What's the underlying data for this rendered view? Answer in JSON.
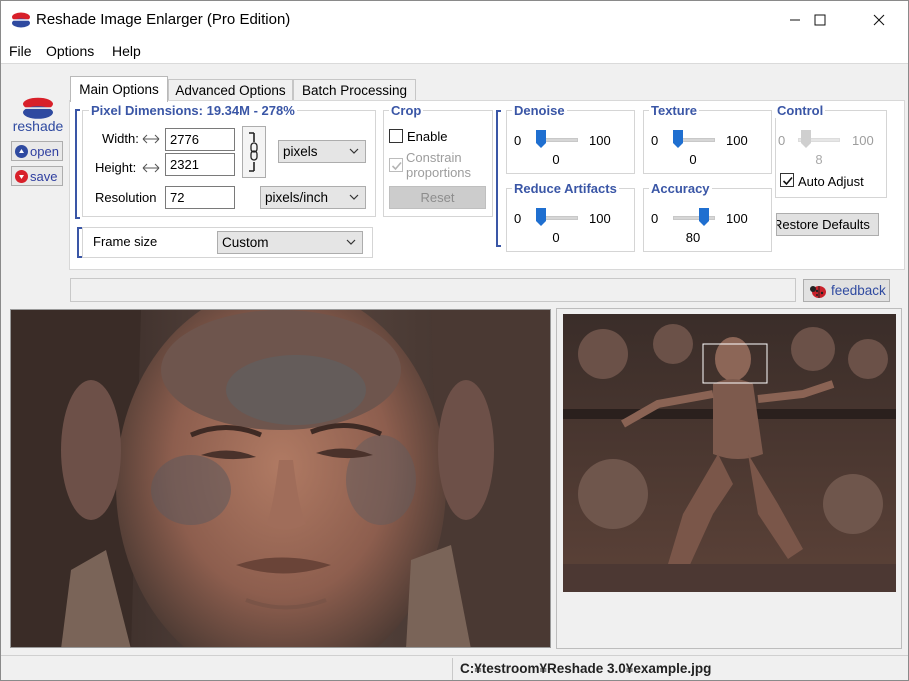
{
  "window": {
    "title": "Reshade Image Enlarger (Pro Edition)",
    "minimize_glyph": "—",
    "maximize_glyph": "☐",
    "close_glyph": "✕"
  },
  "menu": [
    "File",
    "Options",
    "Help"
  ],
  "sidebar": {
    "brand": "reshade",
    "open_label": "open",
    "save_label": "save"
  },
  "tabs": [
    "Main Options",
    "Advanced Options",
    "Batch Processing"
  ],
  "active_tab": "Main Options",
  "pixel_dimensions": {
    "title": "Pixel Dimensions:  19.34M - 278%",
    "width_label": "Width:",
    "width_value": "2776",
    "height_label": "Height:",
    "height_value": "2321",
    "unit": "pixels",
    "resolution_label": "Resolution",
    "resolution_value": "72",
    "resolution_unit": "pixels/inch"
  },
  "frame": {
    "label": "Frame size",
    "value": "Custom"
  },
  "crop": {
    "title": "Crop",
    "enable_label": "Enable",
    "enable_checked": false,
    "constrain_line1": "Constrain",
    "constrain_line2": "proportions",
    "constrain_checked": true,
    "reset_label": "Reset"
  },
  "sliders": {
    "denoise": {
      "title": "Denoise",
      "min": "0",
      "max": "100",
      "value": "0",
      "level": 0
    },
    "texture": {
      "title": "Texture",
      "min": "0",
      "max": "100",
      "value": "0",
      "level": 0
    },
    "control": {
      "title": "Control",
      "min": "0",
      "max": "100",
      "value": "8",
      "level": 0.08
    },
    "reduce": {
      "title": "Reduce Artifacts",
      "min": "0",
      "max": "100",
      "value": "0",
      "level": 0
    },
    "accuracy": {
      "title": "Accuracy",
      "min": "0",
      "max": "100",
      "value": "80",
      "level": 0.8
    }
  },
  "auto_adjust": {
    "label": "Auto Adjust",
    "checked": true
  },
  "restore_defaults_label": "Restore Defaults",
  "feedback_label": "feedback",
  "status": {
    "path": "C:¥testroom¥Reshade 3.0¥example.jpg"
  },
  "colors": {
    "accent": "#3a56a6",
    "slider_thumb": "#1f6fd0",
    "brand_red": "#d8202a",
    "brand_blue": "#2f4aa0"
  }
}
